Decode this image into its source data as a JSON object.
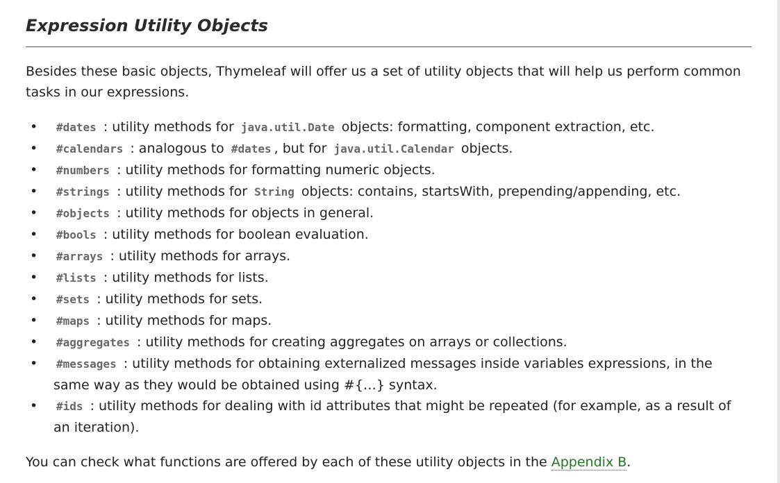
{
  "heading": "Expression Utility Objects",
  "intro": "Besides these basic objects, Thymeleaf will offer us a set of utility objects that will help us perform common tasks in our expressions.",
  "items": [
    {
      "code": "#dates",
      "t1": " : utility methods for ",
      "c2": "java.util.Date",
      "t2": " objects: formatting, component extraction, etc."
    },
    {
      "code": "#calendars",
      "t1": " : analogous to ",
      "c2": "#dates",
      "t2": ", but for ",
      "c3": "java.util.Calendar",
      "t3": " objects."
    },
    {
      "code": "#numbers",
      "t1": " : utility methods for formatting numeric objects."
    },
    {
      "code": "#strings",
      "t1": " : utility methods for ",
      "c2": "String",
      "t2": " objects: contains, startsWith, prepending/appending, etc."
    },
    {
      "code": "#objects",
      "t1": " : utility methods for objects in general."
    },
    {
      "code": "#bools",
      "t1": " : utility methods for boolean evaluation."
    },
    {
      "code": "#arrays",
      "t1": " : utility methods for arrays."
    },
    {
      "code": "#lists",
      "t1": " : utility methods for lists."
    },
    {
      "code": "#sets",
      "t1": " : utility methods for sets."
    },
    {
      "code": "#maps",
      "t1": " : utility methods for maps."
    },
    {
      "code": "#aggregates",
      "t1": " : utility methods for creating aggregates on arrays or collections."
    },
    {
      "code": "#messages",
      "t1": " : utility methods for obtaining externalized messages inside variables expressions, in the same way as they would be obtained using #{…} syntax."
    },
    {
      "code": "#ids",
      "t1": " : utility methods for dealing with id attributes that might be repeated (for example, as a result of an iteration)."
    }
  ],
  "outro": {
    "prefix": "You can check what functions are offered by each of these utility objects in the ",
    "link_text": "Appendix B",
    "suffix": "."
  },
  "colors": {
    "link": "#1f7a1f",
    "rule": "#2c7a2c",
    "code": "#666666"
  }
}
